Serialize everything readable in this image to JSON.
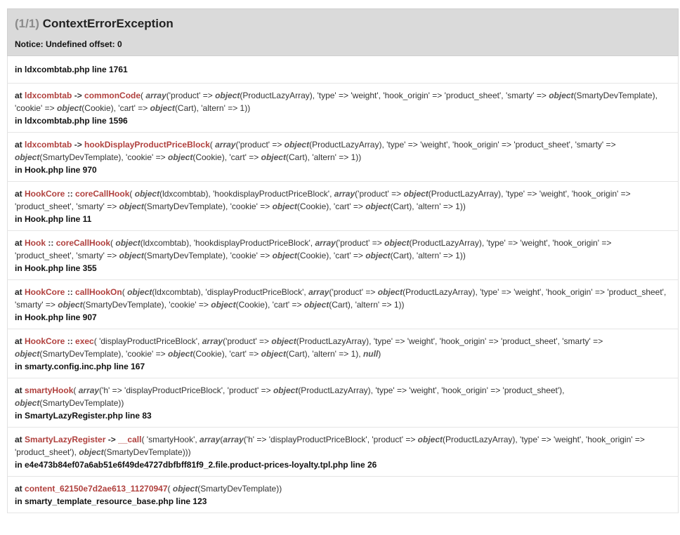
{
  "header": {
    "count": "(1/1)",
    "exception": "ContextErrorException",
    "message": "Notice: Undefined offset: 0"
  },
  "first_location": "in ldxcombtab.php line 1761",
  "frames": [
    {
      "at": "at",
      "parts": [
        {
          "t": "cls",
          "v": "ldxcombtab"
        },
        {
          "t": "sep",
          "v": " -> "
        },
        {
          "t": "fn",
          "v": "commonCode"
        },
        {
          "t": "txt",
          "v": "( "
        },
        {
          "t": "arr",
          "v": "array"
        },
        {
          "t": "txt",
          "v": "('product' => "
        },
        {
          "t": "obj",
          "v": "object"
        },
        {
          "t": "txt",
          "v": "(ProductLazyArray), 'type' => 'weight', 'hook_origin' => 'product_sheet', 'smarty' => "
        },
        {
          "t": "obj",
          "v": "object"
        },
        {
          "t": "txt",
          "v": "(SmartyDevTemplate), 'cookie' => "
        },
        {
          "t": "obj",
          "v": "object"
        },
        {
          "t": "txt",
          "v": "(Cookie), 'cart' => "
        },
        {
          "t": "obj",
          "v": "object"
        },
        {
          "t": "txt",
          "v": "(Cart), 'altern' => 1))"
        }
      ],
      "location": "in ldxcombtab.php line 1596"
    },
    {
      "at": "at",
      "parts": [
        {
          "t": "cls",
          "v": "ldxcombtab"
        },
        {
          "t": "sep",
          "v": " -> "
        },
        {
          "t": "fn",
          "v": "hookDisplayProductPriceBlock"
        },
        {
          "t": "txt",
          "v": "( "
        },
        {
          "t": "arr",
          "v": "array"
        },
        {
          "t": "txt",
          "v": "('product' => "
        },
        {
          "t": "obj",
          "v": "object"
        },
        {
          "t": "txt",
          "v": "(ProductLazyArray), 'type' => 'weight', 'hook_origin' => 'product_sheet', 'smarty' => "
        },
        {
          "t": "obj",
          "v": "object"
        },
        {
          "t": "txt",
          "v": "(SmartyDevTemplate), 'cookie' => "
        },
        {
          "t": "obj",
          "v": "object"
        },
        {
          "t": "txt",
          "v": "(Cookie), 'cart' => "
        },
        {
          "t": "obj",
          "v": "object"
        },
        {
          "t": "txt",
          "v": "(Cart), 'altern' => 1))"
        }
      ],
      "location": "in Hook.php line 970"
    },
    {
      "at": "at",
      "parts": [
        {
          "t": "cls",
          "v": "HookCore"
        },
        {
          "t": "sep",
          "v": " :: "
        },
        {
          "t": "fn",
          "v": "coreCallHook"
        },
        {
          "t": "txt",
          "v": "( "
        },
        {
          "t": "obj",
          "v": "object"
        },
        {
          "t": "txt",
          "v": "(ldxcombtab), 'hookdisplayProductPriceBlock', "
        },
        {
          "t": "arr",
          "v": "array"
        },
        {
          "t": "txt",
          "v": "('product' => "
        },
        {
          "t": "obj",
          "v": "object"
        },
        {
          "t": "txt",
          "v": "(ProductLazyArray), 'type' => 'weight', 'hook_origin' => 'product_sheet', 'smarty' => "
        },
        {
          "t": "obj",
          "v": "object"
        },
        {
          "t": "txt",
          "v": "(SmartyDevTemplate), 'cookie' => "
        },
        {
          "t": "obj",
          "v": "object"
        },
        {
          "t": "txt",
          "v": "(Cookie), 'cart' => "
        },
        {
          "t": "obj",
          "v": "object"
        },
        {
          "t": "txt",
          "v": "(Cart), 'altern' => 1))"
        }
      ],
      "location": "in Hook.php line 11"
    },
    {
      "at": "at",
      "parts": [
        {
          "t": "cls",
          "v": "Hook"
        },
        {
          "t": "sep",
          "v": " :: "
        },
        {
          "t": "fn",
          "v": "coreCallHook"
        },
        {
          "t": "txt",
          "v": "( "
        },
        {
          "t": "obj",
          "v": "object"
        },
        {
          "t": "txt",
          "v": "(ldxcombtab), 'hookdisplayProductPriceBlock', "
        },
        {
          "t": "arr",
          "v": "array"
        },
        {
          "t": "txt",
          "v": "('product' => "
        },
        {
          "t": "obj",
          "v": "object"
        },
        {
          "t": "txt",
          "v": "(ProductLazyArray), 'type' => 'weight', 'hook_origin' => 'product_sheet', 'smarty' => "
        },
        {
          "t": "obj",
          "v": "object"
        },
        {
          "t": "txt",
          "v": "(SmartyDevTemplate), 'cookie' => "
        },
        {
          "t": "obj",
          "v": "object"
        },
        {
          "t": "txt",
          "v": "(Cookie), 'cart' => "
        },
        {
          "t": "obj",
          "v": "object"
        },
        {
          "t": "txt",
          "v": "(Cart), 'altern' => 1))"
        }
      ],
      "location": "in Hook.php line 355"
    },
    {
      "at": "at",
      "parts": [
        {
          "t": "cls",
          "v": "HookCore"
        },
        {
          "t": "sep",
          "v": " :: "
        },
        {
          "t": "fn",
          "v": "callHookOn"
        },
        {
          "t": "txt",
          "v": "( "
        },
        {
          "t": "obj",
          "v": "object"
        },
        {
          "t": "txt",
          "v": "(ldxcombtab), 'displayProductPriceBlock', "
        },
        {
          "t": "arr",
          "v": "array"
        },
        {
          "t": "txt",
          "v": "('product' => "
        },
        {
          "t": "obj",
          "v": "object"
        },
        {
          "t": "txt",
          "v": "(ProductLazyArray), 'type' => 'weight', 'hook_origin' => 'product_sheet', 'smarty' => "
        },
        {
          "t": "obj",
          "v": "object"
        },
        {
          "t": "txt",
          "v": "(SmartyDevTemplate), 'cookie' => "
        },
        {
          "t": "obj",
          "v": "object"
        },
        {
          "t": "txt",
          "v": "(Cookie), 'cart' => "
        },
        {
          "t": "obj",
          "v": "object"
        },
        {
          "t": "txt",
          "v": "(Cart), 'altern' => 1))"
        }
      ],
      "location": "in Hook.php line 907"
    },
    {
      "at": "at",
      "parts": [
        {
          "t": "cls",
          "v": "HookCore"
        },
        {
          "t": "sep",
          "v": " :: "
        },
        {
          "t": "fn",
          "v": "exec"
        },
        {
          "t": "txt",
          "v": "( 'displayProductPriceBlock', "
        },
        {
          "t": "arr",
          "v": "array"
        },
        {
          "t": "txt",
          "v": "('product' => "
        },
        {
          "t": "obj",
          "v": "object"
        },
        {
          "t": "txt",
          "v": "(ProductLazyArray), 'type' => 'weight', 'hook_origin' => 'product_sheet', 'smarty' => "
        },
        {
          "t": "obj",
          "v": "object"
        },
        {
          "t": "txt",
          "v": "(SmartyDevTemplate), 'cookie' => "
        },
        {
          "t": "obj",
          "v": "object"
        },
        {
          "t": "txt",
          "v": "(Cookie), 'cart' => "
        },
        {
          "t": "obj",
          "v": "object"
        },
        {
          "t": "txt",
          "v": "(Cart), 'altern' => 1), "
        },
        {
          "t": "nul",
          "v": "null"
        },
        {
          "t": "txt",
          "v": ")"
        }
      ],
      "location": "in smarty.config.inc.php line 167"
    },
    {
      "at": "at",
      "parts": [
        {
          "t": "fn",
          "v": " smartyHook"
        },
        {
          "t": "txt",
          "v": "( "
        },
        {
          "t": "arr",
          "v": "array"
        },
        {
          "t": "txt",
          "v": "('h' => 'displayProductPriceBlock', 'product' => "
        },
        {
          "t": "obj",
          "v": "object"
        },
        {
          "t": "txt",
          "v": "(ProductLazyArray), 'type' => 'weight', 'hook_origin' => 'product_sheet'), "
        },
        {
          "t": "obj",
          "v": "object"
        },
        {
          "t": "txt",
          "v": "(SmartyDevTemplate))"
        }
      ],
      "location": "in SmartyLazyRegister.php line 83"
    },
    {
      "at": "at",
      "parts": [
        {
          "t": "cls",
          "v": "SmartyLazyRegister"
        },
        {
          "t": "sep",
          "v": " -> "
        },
        {
          "t": "fn",
          "v": "__call"
        },
        {
          "t": "txt",
          "v": "( 'smartyHook', "
        },
        {
          "t": "arr",
          "v": "array"
        },
        {
          "t": "txt",
          "v": "("
        },
        {
          "t": "arr",
          "v": "array"
        },
        {
          "t": "txt",
          "v": "('h' => 'displayProductPriceBlock', 'product' => "
        },
        {
          "t": "obj",
          "v": "object"
        },
        {
          "t": "txt",
          "v": "(ProductLazyArray), 'type' => 'weight', 'hook_origin' => 'product_sheet'), "
        },
        {
          "t": "obj",
          "v": "object"
        },
        {
          "t": "txt",
          "v": "(SmartyDevTemplate)))"
        }
      ],
      "location": "in e4e473b84ef07a6ab51e6f49de4727dbfbff81f9_2.file.product-prices-loyalty.tpl.php line 26"
    },
    {
      "at": "at",
      "parts": [
        {
          "t": "fn",
          "v": " content_62150e7d2ae613_11270947"
        },
        {
          "t": "txt",
          "v": "( "
        },
        {
          "t": "obj",
          "v": "object"
        },
        {
          "t": "txt",
          "v": "(SmartyDevTemplate))"
        }
      ],
      "location": "in smarty_template_resource_base.php line 123"
    }
  ]
}
